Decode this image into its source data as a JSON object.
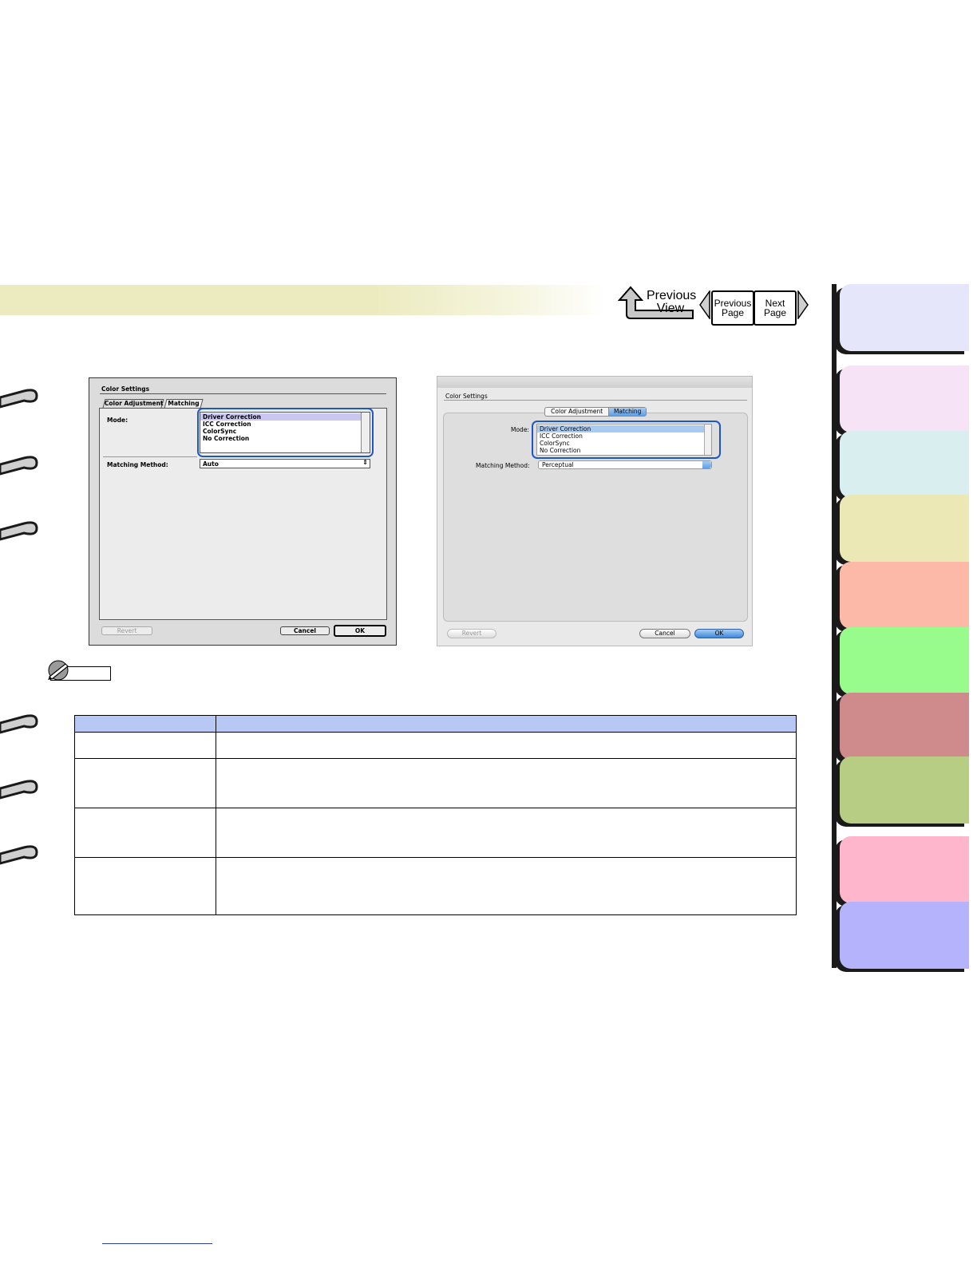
{
  "nav": {
    "previous_view_label_1": "Previous",
    "previous_view_label_2": "View",
    "previous_page_label_1": "Previous",
    "previous_page_label_2": "Page",
    "next_page_label_1": "Next",
    "next_page_label_2": "Page"
  },
  "side_tabs": {
    "colors": [
      "#e6e6fb",
      "#f7e3f6",
      "#d9efef",
      "#ece8b5",
      "#fdb9a8",
      "#98fc8c",
      "#cf8a8c",
      "#b7cd83",
      "#feb6cc",
      "#b4b3fc"
    ]
  },
  "dialog_os9": {
    "title": "Color Settings",
    "tabs": [
      "Color Adjustment",
      "Matching"
    ],
    "active_tab": "Matching",
    "mode_label": "Mode:",
    "mode_options": [
      "Driver Correction",
      "ICC Correction",
      "ColorSync",
      "No Correction"
    ],
    "mode_selected": "Driver Correction",
    "matching_method_label": "Matching Method:",
    "matching_method_value": "Auto",
    "revert_label": "Revert",
    "cancel_label": "Cancel",
    "ok_label": "OK"
  },
  "dialog_osx": {
    "title": "Color Settings",
    "tabs": [
      "Color Adjustment",
      "Matching"
    ],
    "active_tab": "Matching",
    "mode_label": "Mode:",
    "mode_options": [
      "Driver Correction",
      "ICC Correction",
      "ColorSync",
      "No Correction"
    ],
    "mode_selected": "Driver Correction",
    "matching_method_label": "Matching Method:",
    "matching_method_value": "Perceptual",
    "revert_label": "Revert",
    "cancel_label": "Cancel",
    "ok_label": "OK"
  },
  "highlight_color": "#1f56c7",
  "table": {
    "header_color": "#b7c8f5",
    "rows": 4
  }
}
